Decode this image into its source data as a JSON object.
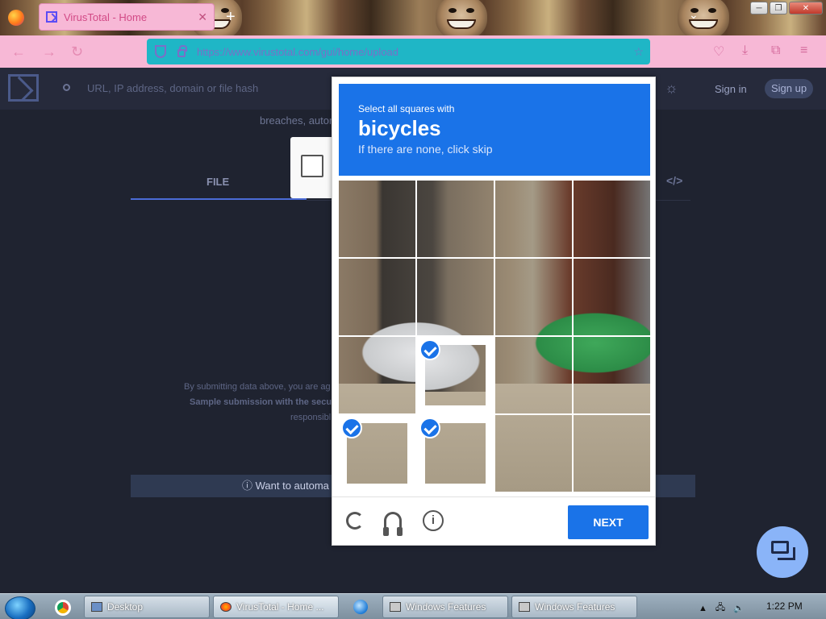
{
  "browser": {
    "tab_title": "VirusTotal - Home",
    "tab_close": "✕",
    "new_tab": "+",
    "url": "https://www.virustotal.com/gui/home/upload",
    "window_buttons": [
      "─",
      "❐",
      "✕"
    ]
  },
  "vt": {
    "search_placeholder": "URL, IP address, domain or file hash",
    "sign_in": "Sign in",
    "sign_up": "Sign up",
    "breaches_text": "breaches, autor",
    "file_tab": "FILE",
    "disclaimer_1": "By submitting data above, you are ag",
    "disclaimer_2": "Sample submission with the secu",
    "disclaimer_3": "responsibl",
    "banner_text": "ⓘ Want to automa"
  },
  "captcha": {
    "instruction": "Select all squares with",
    "target": "bicycles",
    "hint": "If there are none, click skip",
    "next_label": "NEXT",
    "info_glyph": "i",
    "selected_tiles": [
      9,
      12,
      13
    ]
  },
  "taskbar": {
    "desktop": "Desktop",
    "firefox": "VirusTotal - Home ...",
    "features_1": "Windows Features",
    "features_2": "Windows Features",
    "time": "1:22 PM"
  }
}
